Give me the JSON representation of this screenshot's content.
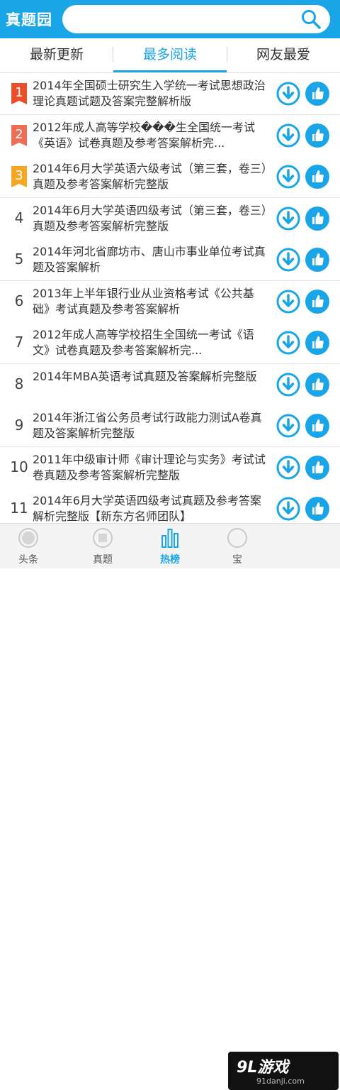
{
  "header": {
    "app_title": "真题园",
    "search_placeholder": ""
  },
  "tabs": [
    {
      "label": "最新更新",
      "active": false
    },
    {
      "label": "最多阅读",
      "active": true
    },
    {
      "label": "网友最爱",
      "active": false
    }
  ],
  "list": [
    {
      "rank": "1",
      "title": "2014年全国硕士研究生入学统一考试思想政治理论真题试题及答案完整解析版"
    },
    {
      "rank": "2",
      "title": "2012年成人高等学校���生全国统一考试《英语》试卷真题及参考答案解析完..."
    },
    {
      "rank": "3",
      "title": "2014年6月大学英语六级考试（第三套，卷三）真题及参考答案解析完整版"
    },
    {
      "rank": "4",
      "title": "2014年6月大学英语四级考试（第三套，卷三）真题及参考答案解析完整版"
    },
    {
      "rank": "5",
      "title": "2014年河北省廊坊市、唐山市事业单位考试真题及答案解析"
    },
    {
      "rank": "6",
      "title": "2013年上半年银行业从业资格考试《公共基础》考试真题及参考答案解析"
    },
    {
      "rank": "7",
      "title": "2012年成人高等学校招生全国统一考试《语文》试卷真题及参考答案解析完..."
    },
    {
      "rank": "8",
      "title": "2014年MBA英语考试真题及答案解析完整版"
    },
    {
      "rank": "9",
      "title": "2014年浙江省公务员考试行政能力测试A卷真题及答案解析完整版"
    },
    {
      "rank": "10",
      "title": "2011年中级审计师《审计理论与实务》考试试卷真题及参考答案解析完整版"
    },
    {
      "rank": "11",
      "title": "2014年6月大学英语四级考试真题及参考答案解析完整版【新东方名师团队】"
    }
  ],
  "rank_badge_colors": [
    "#e8502a",
    "#f06d55",
    "#f5a623"
  ],
  "bottom_nav": [
    {
      "label": "头条",
      "icon": "news-icon",
      "active": false
    },
    {
      "label": "真题",
      "icon": "exam-icon",
      "active": false
    },
    {
      "label": "热榜",
      "icon": "chart-icon",
      "active": true
    },
    {
      "label": "宝",
      "icon": "treasure-icon",
      "active": false
    }
  ],
  "watermark": {
    "main": "9L游戏",
    "sub": "91danji.com"
  },
  "colors": {
    "accent": "#1aa6e6"
  }
}
